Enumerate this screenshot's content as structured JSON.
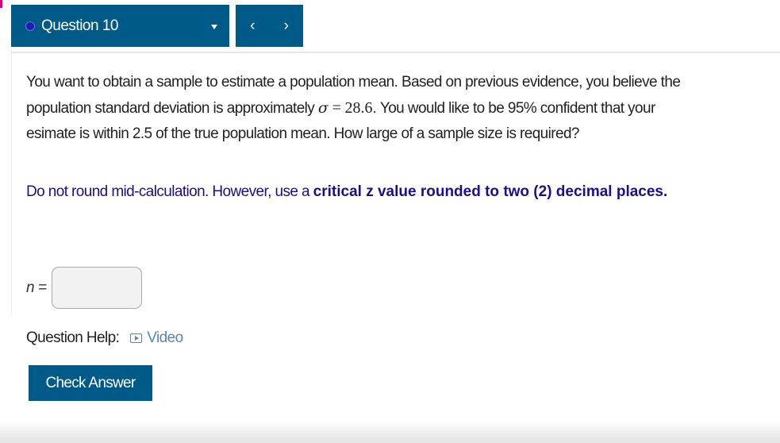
{
  "header": {
    "question_label": "Question 10",
    "prev_glyph": "‹",
    "next_glyph": "›",
    "status_icon": "status-dot-icon",
    "dropdown_icon": "caret-down-icon",
    "colors": {
      "header_bg": "#005a87",
      "status_dot": "#1e1ea8"
    }
  },
  "question": {
    "text_part1": "You want to obtain a sample to estimate a population mean. Based on previous evidence, you believe the population standard deviation is approximately ",
    "sigma_symbol": "σ",
    "equals_symbol": "=",
    "sigma_value": "28.6",
    "text_part2": ". You would like to be 95% confident that your esimate is within 2.5 of the true population mean. How large of a sample size is required?"
  },
  "instruction": {
    "plain": "Do not round mid-calculation. However, use a ",
    "bold": "critical z value rounded to two (2) decimal places.",
    "color": "#1e0d8c"
  },
  "answer": {
    "variable": "n",
    "equals": " =",
    "value": ""
  },
  "help": {
    "label": "Question Help:",
    "video_label": "Video",
    "video_icon": "video-play-icon"
  },
  "actions": {
    "check_answer_label": "Check Answer"
  }
}
